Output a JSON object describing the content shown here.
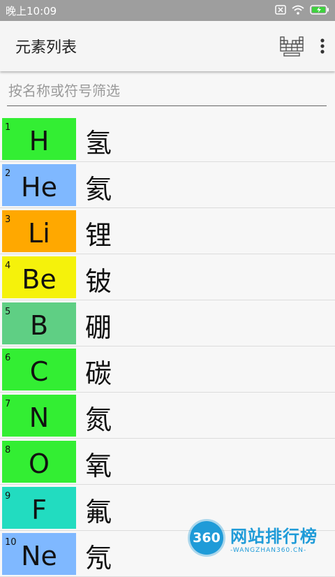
{
  "status": {
    "time": "晚上10:09"
  },
  "appbar": {
    "title": "元素列表"
  },
  "filter": {
    "placeholder": "按名称或符号筛选"
  },
  "elements": [
    {
      "number": "1",
      "symbol": "H",
      "name": "氢",
      "color": "#33ee33"
    },
    {
      "number": "2",
      "symbol": "He",
      "name": "氦",
      "color": "#7fb8ff"
    },
    {
      "number": "3",
      "symbol": "Li",
      "name": "锂",
      "color": "#ffa800"
    },
    {
      "number": "4",
      "symbol": "Be",
      "name": "铍",
      "color": "#f5f20b"
    },
    {
      "number": "5",
      "symbol": "B",
      "name": "硼",
      "color": "#5fcf84"
    },
    {
      "number": "6",
      "symbol": "C",
      "name": "碳",
      "color": "#33ee33"
    },
    {
      "number": "7",
      "symbol": "N",
      "name": "氮",
      "color": "#33ee33"
    },
    {
      "number": "8",
      "symbol": "O",
      "name": "氧",
      "color": "#33ee33"
    },
    {
      "number": "9",
      "symbol": "F",
      "name": "氟",
      "color": "#22dcc0"
    },
    {
      "number": "10",
      "symbol": "Ne",
      "name": "氖",
      "color": "#7fb8ff"
    }
  ],
  "watermark": {
    "logo": "360",
    "main": "网站排行榜",
    "sub": "-WANGZHAN360.CN-"
  }
}
